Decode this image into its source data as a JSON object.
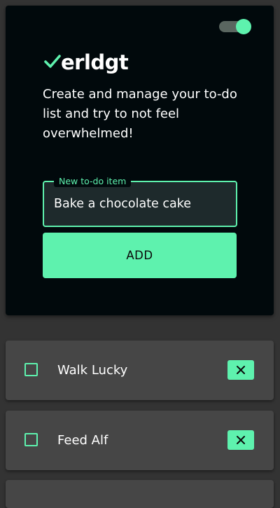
{
  "theme": {
    "accent": "#5ef2ae",
    "hero_background": "#01090c",
    "page_background": "#333333",
    "card_background": "#464646"
  },
  "theme_toggle": {
    "state": "on"
  },
  "brand": {
    "logo_icon": "checkmark-icon",
    "name": "erldgt"
  },
  "intro": {
    "tagline": "Create and manage your to-do list and try to not feel overwhelmed!"
  },
  "new_todo": {
    "label": "New to-do item",
    "value": "Bake a chocolate cake"
  },
  "add_button": {
    "label": "ADD"
  },
  "todos": [
    {
      "text": "Walk Lucky",
      "checked": false,
      "delete_icon": "close-icon"
    },
    {
      "text": "Feed Alf",
      "checked": false,
      "delete_icon": "close-icon"
    }
  ]
}
